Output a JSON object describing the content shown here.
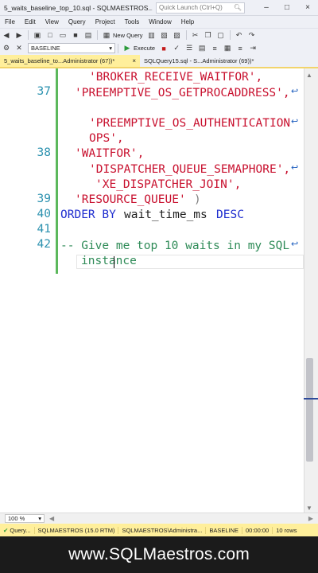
{
  "window": {
    "title": "5_waits_baseline_top_10.sql - SQLMAESTROS...",
    "quick_launch_placeholder": "Quick Launch (Ctrl+Q)",
    "minimize": "–",
    "maximize": "□",
    "close": "×"
  },
  "menu": [
    "File",
    "Edit",
    "View",
    "Query",
    "Project",
    "Tools",
    "Window",
    "Help"
  ],
  "toolbar": {
    "new_query_label": "New Query",
    "database": "BASELINE",
    "execute_label": "Execute"
  },
  "tabs": [
    {
      "label": "5_waits_baseline_to...Administrator (67))*",
      "close": "×",
      "active": true
    },
    {
      "label": "SQLQuery15.sql - S...Administrator (69))*",
      "close": "",
      "active": false
    }
  ],
  "editor": {
    "line_numbers": [
      "37",
      "38",
      "39",
      "40",
      "41",
      "42"
    ],
    "lines": [
      "'BROKER_RECEIVE_WAITFOR',",
      "'PREEMPTIVE_OS_GETPROCADDRESS',",
      "'PREEMPTIVE_OS_AUTHENTICATION",
      "OPS',",
      "'WAITFOR',",
      "'DISPATCHER_QUEUE_SEMAPHORE',",
      "'XE_DISPATCHER_JOIN',",
      "'RESOURCE_QUEUE'",
      ")",
      "ORDER BY",
      "wait_time_ms",
      "DESC",
      "-- Give me top 10 waits in my SQL",
      "instance"
    ],
    "wrap_glyph": "↩"
  },
  "zoom": "100 %",
  "status": {
    "query_state": "Query...",
    "server": "SQLMAESTROS (15.0 RTM)",
    "login": "SQLMAESTROS\\Administra...",
    "database": "BASELINE",
    "elapsed": "00:00:00",
    "rows": "10 rows"
  },
  "footer": "www.SQLMaestros.com",
  "colors": {
    "string": "#c8102e",
    "keyword": "#1f2ecf",
    "comment": "#2e8b57",
    "line_number": "#2b91af",
    "tab_active": "#ffef9b",
    "status_bar": "#ffef9b"
  }
}
